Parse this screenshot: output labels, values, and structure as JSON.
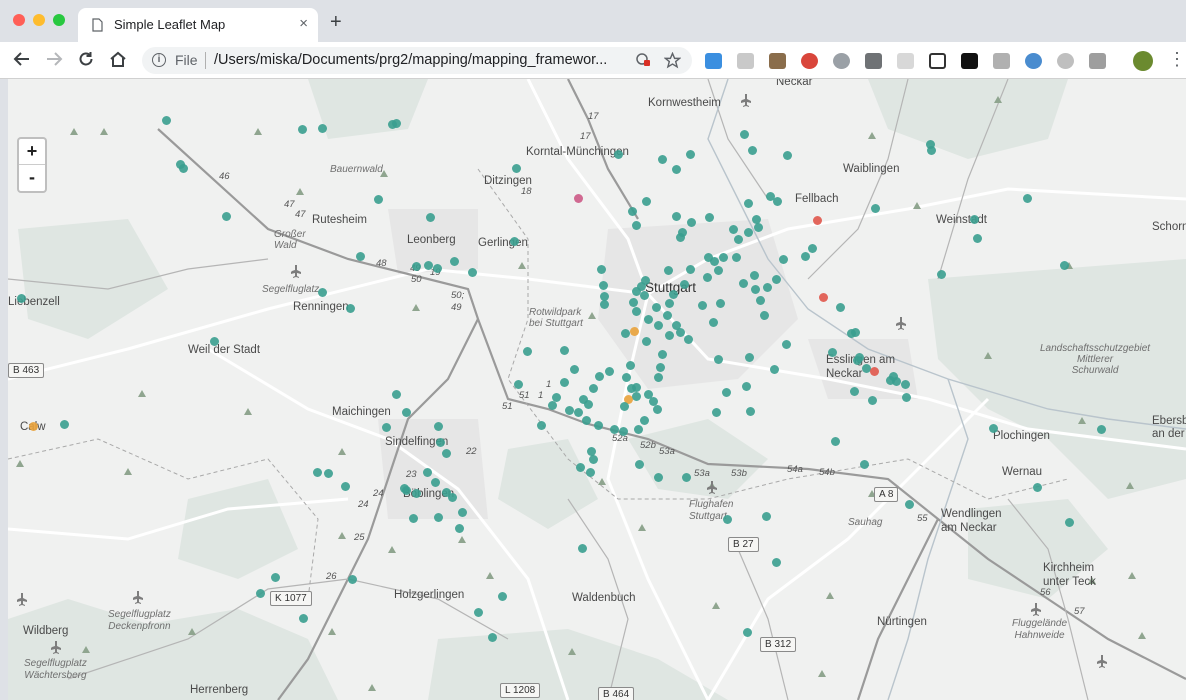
{
  "window": {
    "traffic": [
      "#ff5f57",
      "#febc2e",
      "#28c840"
    ]
  },
  "tab": {
    "title": "Simple Leaflet Map",
    "close": "×"
  },
  "new_tab": "+",
  "omnibox": {
    "scheme": "File",
    "url": "/Users/miska/Documents/prg2/mapping/mapping_framewor..."
  },
  "zoom": {
    "in": "+",
    "out": "-"
  },
  "colors": {
    "teal": "#3a9e8f",
    "pink": "#cc5a86",
    "red": "#e0574b",
    "orange": "#e9a23b",
    "road": "#ffffff",
    "highway": "#9a9a9a"
  },
  "labels": {
    "neckar_top": "Neckar",
    "kornwestheim": "Kornwestheim",
    "korntal": "Korntal-Münchingen",
    "waiblingen": "Waiblingen",
    "bauernwald": "Bauernwald",
    "ditzingen": "Ditzingen",
    "fellbach": "Fellbach",
    "weinstadt": "Weinstadt",
    "schorn": "Schorn",
    "rutesheim": "Rutesheim",
    "grosser_wald": "Großer\nWald",
    "leonberg": "Leonberg",
    "gerlingen": "Gerlingen",
    "stuttgart": "Stuttgart",
    "segelflug1": "Segelfluglatz",
    "renningen": "Renningen",
    "leibenzell": "Liebenzell",
    "rotwild": "Rotwildpark\nbei Stuttgart",
    "weil": "Weil der Stadt",
    "esslingen": "Esslingen am\nNeckar",
    "landschaft": "Landschaftsschutzgebiet\nMittlerer\nSchurwald",
    "maichingen": "Maichingen",
    "calw": "Calw",
    "sindelfingen": "Sindelfingen",
    "plochingen": "Plochingen",
    "ebersb": "Ebersb\nan der",
    "wernau": "Wernau",
    "boblingen": "Böblingen",
    "flughafen": "Flughafen\nStuttgart",
    "sauhag": "Sauhag",
    "wendlingen": "Wendlingen\nam Neckar",
    "kirchheim": "Kirchheim\nunter Teck",
    "holzgerlingen": "Holzgerlingen",
    "waldenbuch": "Waldenbuch",
    "nurtingen": "Nürtingen",
    "wildberg": "Wildberg",
    "segelflug2": "Segelflugplatz\nDeckenpfronn",
    "fluggelande": "Fluggelände\nHahnweide",
    "segelflug3": "Segelflugplatz\nWächtersberg",
    "herrenberg": "Herrenberg"
  },
  "shields": {
    "b463": "B 463",
    "a8": "A 8",
    "b27": "B 27",
    "k1077": "K 1077",
    "b312": "B 312",
    "l1208": "L 1208",
    "b464": "B 464"
  },
  "road_numbers": {
    "n17a": "17",
    "n17b": "17",
    "n46": "46",
    "n47a": "47",
    "n47b": "47",
    "n18": "18",
    "n48": "48",
    "n49a": "49",
    "n50a": "50",
    "n19": "19",
    "n50b": "50;",
    "n49b": "49",
    "n51a": "51",
    "n51b": "51",
    "n1a": "1",
    "n1b": "1",
    "n52a": "52a",
    "n52b": "52b",
    "n53a": "53a",
    "n53a2": "53a",
    "n53b": "53b",
    "n54a": "54a",
    "n54b": "54b",
    "n55": "55",
    "n23": "23",
    "n22": "22",
    "n24a": "24",
    "n24b": "24",
    "n25": "25",
    "n26": "26",
    "n56": "56",
    "n57": "57"
  },
  "markers": [
    [
      158,
      41,
      "teal"
    ],
    [
      294,
      50,
      "teal"
    ],
    [
      314,
      49,
      "teal"
    ],
    [
      384,
      45,
      "teal"
    ],
    [
      388,
      44,
      "teal"
    ],
    [
      172,
      85,
      "teal"
    ],
    [
      175,
      89,
      "teal"
    ],
    [
      218,
      137,
      "teal"
    ],
    [
      370,
      120,
      "teal"
    ],
    [
      422,
      138,
      "teal"
    ],
    [
      506,
      162,
      "teal"
    ],
    [
      508,
      89,
      "teal"
    ],
    [
      446,
      182,
      "teal"
    ],
    [
      408,
      187,
      "teal"
    ],
    [
      420,
      186,
      "teal"
    ],
    [
      429,
      189,
      "teal"
    ],
    [
      352,
      177,
      "teal"
    ],
    [
      314,
      213,
      "teal"
    ],
    [
      342,
      229,
      "teal"
    ],
    [
      13,
      219,
      "teal"
    ],
    [
      206,
      262,
      "teal"
    ],
    [
      464,
      193,
      "teal"
    ],
    [
      570,
      119,
      "pink"
    ],
    [
      654,
      80,
      "teal"
    ],
    [
      668,
      90,
      "teal"
    ],
    [
      682,
      75,
      "teal"
    ],
    [
      610,
      75,
      "teal"
    ],
    [
      736,
      55,
      "teal"
    ],
    [
      744,
      71,
      "teal"
    ],
    [
      779,
      76,
      "teal"
    ],
    [
      922,
      65,
      "teal"
    ],
    [
      923,
      71,
      "teal"
    ],
    [
      1019,
      119,
      "teal"
    ],
    [
      966,
      140,
      "teal"
    ],
    [
      969,
      159,
      "teal"
    ],
    [
      933,
      195,
      "teal"
    ],
    [
      1056,
      186,
      "teal"
    ],
    [
      867,
      129,
      "teal"
    ],
    [
      809,
      141,
      "red"
    ],
    [
      815,
      218,
      "red"
    ],
    [
      804,
      169,
      "teal"
    ],
    [
      797,
      177,
      "teal"
    ],
    [
      762,
      117,
      "teal"
    ],
    [
      769,
      122,
      "teal"
    ],
    [
      740,
      124,
      "teal"
    ],
    [
      748,
      140,
      "teal"
    ],
    [
      725,
      150,
      "teal"
    ],
    [
      730,
      160,
      "teal"
    ],
    [
      740,
      153,
      "teal"
    ],
    [
      750,
      148,
      "teal"
    ],
    [
      701,
      138,
      "teal"
    ],
    [
      683,
      143,
      "teal"
    ],
    [
      668,
      137,
      "teal"
    ],
    [
      674,
      153,
      "teal"
    ],
    [
      672,
      158,
      "teal"
    ],
    [
      638,
      122,
      "teal"
    ],
    [
      624,
      132,
      "teal"
    ],
    [
      628,
      146,
      "teal"
    ],
    [
      660,
      191,
      "teal"
    ],
    [
      682,
      190,
      "teal"
    ],
    [
      700,
      178,
      "teal"
    ],
    [
      706,
      182,
      "teal"
    ],
    [
      710,
      191,
      "teal"
    ],
    [
      699,
      198,
      "teal"
    ],
    [
      715,
      178,
      "teal"
    ],
    [
      728,
      178,
      "teal"
    ],
    [
      735,
      204,
      "teal"
    ],
    [
      712,
      224,
      "teal"
    ],
    [
      694,
      226,
      "teal"
    ],
    [
      676,
      205,
      "teal"
    ],
    [
      665,
      215,
      "teal"
    ],
    [
      661,
      224,
      "teal"
    ],
    [
      648,
      228,
      "teal"
    ],
    [
      636,
      216,
      "teal"
    ],
    [
      628,
      212,
      "teal"
    ],
    [
      625,
      223,
      "teal"
    ],
    [
      628,
      232,
      "teal"
    ],
    [
      640,
      240,
      "teal"
    ],
    [
      650,
      246,
      "teal"
    ],
    [
      659,
      236,
      "teal"
    ],
    [
      668,
      246,
      "teal"
    ],
    [
      661,
      256,
      "teal"
    ],
    [
      672,
      253,
      "teal"
    ],
    [
      680,
      260,
      "teal"
    ],
    [
      638,
      262,
      "teal"
    ],
    [
      626,
      252,
      "orange"
    ],
    [
      617,
      254,
      "teal"
    ],
    [
      593,
      190,
      "teal"
    ],
    [
      595,
      206,
      "teal"
    ],
    [
      596,
      217,
      "teal"
    ],
    [
      596,
      225,
      "teal"
    ],
    [
      633,
      207,
      "teal"
    ],
    [
      637,
      201,
      "teal"
    ],
    [
      746,
      196,
      "teal"
    ],
    [
      747,
      210,
      "teal"
    ],
    [
      759,
      208,
      "teal"
    ],
    [
      752,
      221,
      "teal"
    ],
    [
      756,
      236,
      "teal"
    ],
    [
      775,
      180,
      "teal"
    ],
    [
      768,
      200,
      "teal"
    ],
    [
      778,
      265,
      "teal"
    ],
    [
      766,
      290,
      "teal"
    ],
    [
      705,
      243,
      "teal"
    ],
    [
      710,
      280,
      "teal"
    ],
    [
      718,
      313,
      "teal"
    ],
    [
      654,
      275,
      "teal"
    ],
    [
      652,
      288,
      "teal"
    ],
    [
      650,
      298,
      "teal"
    ],
    [
      640,
      315,
      "teal"
    ],
    [
      622,
      286,
      "teal"
    ],
    [
      618,
      298,
      "teal"
    ],
    [
      628,
      308,
      "teal"
    ],
    [
      620,
      320,
      "orange"
    ],
    [
      623,
      309,
      "teal"
    ],
    [
      616,
      327,
      "teal"
    ],
    [
      591,
      297,
      "teal"
    ],
    [
      585,
      309,
      "teal"
    ],
    [
      566,
      290,
      "teal"
    ],
    [
      556,
      303,
      "teal"
    ],
    [
      548,
      318,
      "teal"
    ],
    [
      544,
      326,
      "teal"
    ],
    [
      561,
      331,
      "teal"
    ],
    [
      575,
      320,
      "teal"
    ],
    [
      580,
      325,
      "teal"
    ],
    [
      578,
      341,
      "teal"
    ],
    [
      533,
      346,
      "teal"
    ],
    [
      510,
      305,
      "teal"
    ],
    [
      519,
      272,
      "teal"
    ],
    [
      556,
      271,
      "teal"
    ],
    [
      570,
      333,
      "teal"
    ],
    [
      590,
      346,
      "teal"
    ],
    [
      606,
      350,
      "teal"
    ],
    [
      615,
      352,
      "teal"
    ],
    [
      628,
      317,
      "teal"
    ],
    [
      645,
      322,
      "teal"
    ],
    [
      649,
      330,
      "teal"
    ],
    [
      636,
      341,
      "teal"
    ],
    [
      601,
      292,
      "teal"
    ],
    [
      585,
      380,
      "teal"
    ],
    [
      582,
      393,
      "teal"
    ],
    [
      572,
      388,
      "teal"
    ],
    [
      583,
      372,
      "teal"
    ],
    [
      630,
      350,
      "teal"
    ],
    [
      631,
      385,
      "teal"
    ],
    [
      650,
      398,
      "teal"
    ],
    [
      678,
      398,
      "teal"
    ],
    [
      708,
      333,
      "teal"
    ],
    [
      742,
      332,
      "teal"
    ],
    [
      741,
      278,
      "teal"
    ],
    [
      738,
      307,
      "teal"
    ],
    [
      824,
      273,
      "teal"
    ],
    [
      832,
      228,
      "teal"
    ],
    [
      843,
      254,
      "teal"
    ],
    [
      849,
      281,
      "teal"
    ],
    [
      858,
      289,
      "teal"
    ],
    [
      864,
      321,
      "teal"
    ],
    [
      827,
      362,
      "teal"
    ],
    [
      847,
      253,
      "teal"
    ],
    [
      851,
      278,
      "teal"
    ],
    [
      846,
      312,
      "teal"
    ],
    [
      882,
      301,
      "teal"
    ],
    [
      888,
      302,
      "teal"
    ],
    [
      897,
      305,
      "teal"
    ],
    [
      898,
      318,
      "teal"
    ],
    [
      885,
      297,
      "teal"
    ],
    [
      866,
      292,
      "red"
    ],
    [
      1093,
      350,
      "teal"
    ],
    [
      985,
      349,
      "teal"
    ],
    [
      1029,
      408,
      "teal"
    ],
    [
      1061,
      443,
      "teal"
    ],
    [
      901,
      425,
      "teal"
    ],
    [
      856,
      385,
      "teal"
    ],
    [
      388,
      315,
      "teal"
    ],
    [
      398,
      333,
      "teal"
    ],
    [
      430,
      347,
      "teal"
    ],
    [
      432,
      363,
      "teal"
    ],
    [
      438,
      374,
      "teal"
    ],
    [
      419,
      393,
      "teal"
    ],
    [
      427,
      403,
      "teal"
    ],
    [
      438,
      413,
      "teal"
    ],
    [
      444,
      418,
      "teal"
    ],
    [
      454,
      433,
      "teal"
    ],
    [
      430,
      438,
      "teal"
    ],
    [
      405,
      439,
      "teal"
    ],
    [
      408,
      414,
      "teal"
    ],
    [
      398,
      411,
      "teal"
    ],
    [
      396,
      409,
      "teal"
    ],
    [
      309,
      393,
      "teal"
    ],
    [
      337,
      407,
      "teal"
    ],
    [
      378,
      348,
      "teal"
    ],
    [
      320,
      394,
      "teal"
    ],
    [
      56,
      345,
      "teal"
    ],
    [
      25,
      347,
      "orange"
    ],
    [
      252,
      514,
      "teal"
    ],
    [
      267,
      498,
      "teal"
    ],
    [
      295,
      539,
      "teal"
    ],
    [
      344,
      500,
      "teal"
    ],
    [
      451,
      449,
      "teal"
    ],
    [
      470,
      533,
      "teal"
    ],
    [
      484,
      558,
      "teal"
    ],
    [
      494,
      517,
      "teal"
    ],
    [
      574,
      469,
      "teal"
    ],
    [
      719,
      440,
      "teal"
    ],
    [
      758,
      437,
      "teal"
    ],
    [
      768,
      483,
      "teal"
    ],
    [
      739,
      553,
      "teal"
    ]
  ]
}
